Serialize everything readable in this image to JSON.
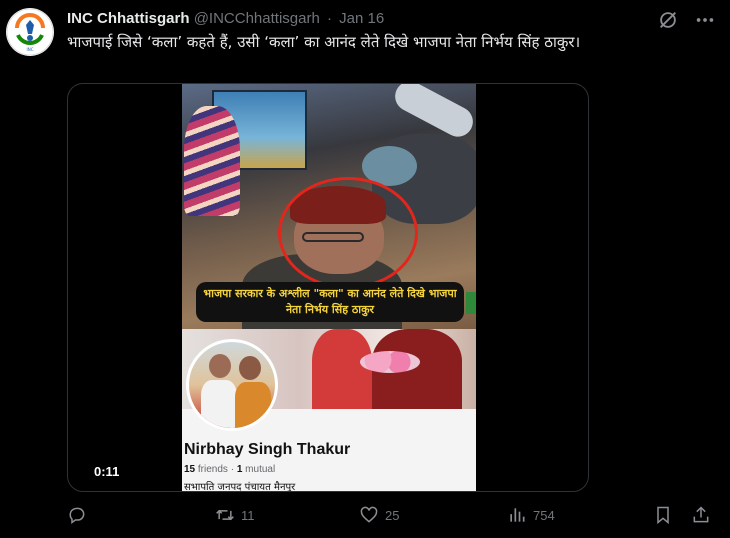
{
  "tweet": {
    "display_name": "INC Chhattisgarh",
    "handle": "@INCChhattisgarh",
    "separator": "·",
    "date": "Jan 16",
    "text": "भाजपाई जिसे ‘कला’ कहते हैं, उसी ‘कला’ का आनंद लेते दिखे भाजपा नेता निर्भय सिंह ठाकुर।",
    "avatar_icon": "congress-logo-icon"
  },
  "media": {
    "caption": "भाजपा सरकार के अश्लील \"कला\" का आनंद लेते दिखे भाजपा नेता निर्भय सिंह ठाकुर",
    "profile_name": "Nirbhay Singh Thakur",
    "friends_count": "15",
    "friends_label": "friends",
    "stats_dot": "·",
    "mutual_count": "1",
    "mutual_label": "mutual",
    "bio": "सभापति जनपद पंचायत मैनपुर",
    "timer": "0:11"
  },
  "actions": {
    "reply_icon": "reply-icon",
    "retweet_icon": "retweet-icon",
    "retweet_count": "11",
    "like_icon": "heart-icon",
    "like_count": "25",
    "views_icon": "views-icon",
    "views_count": "754",
    "bookmark_icon": "bookmark-icon",
    "share_icon": "share-icon"
  },
  "colors": {
    "background": "#000000",
    "text_primary": "#e7e9ea",
    "text_secondary": "#71767b",
    "highlight_circle": "#e3261c",
    "caption_text": "#f5d43b"
  }
}
